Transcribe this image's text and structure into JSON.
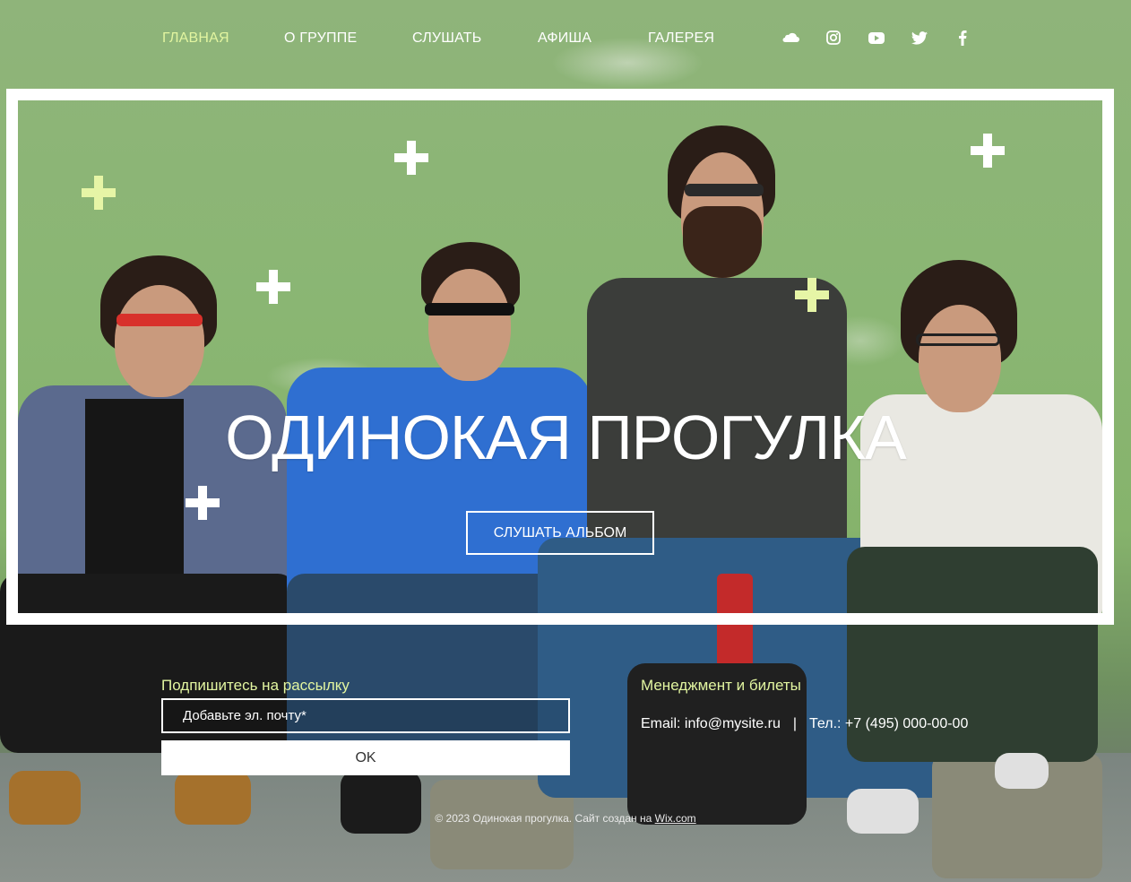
{
  "nav": {
    "items": [
      {
        "label": "ГЛАВНАЯ"
      },
      {
        "label": "О ГРУППЕ"
      },
      {
        "label": "СЛУШАТЬ"
      },
      {
        "label": "АФИША"
      },
      {
        "label": "ГАЛЕРЕЯ"
      }
    ],
    "social": [
      "soundcloud-icon",
      "instagram-icon",
      "youtube-icon",
      "twitter-icon",
      "facebook-icon"
    ]
  },
  "hero": {
    "title": "ОДИНОКАЯ ПРОГУЛКА",
    "button_label": "СЛУШАТЬ АЛЬБОМ"
  },
  "newsletter": {
    "title": "Подпишитесь на рассылку",
    "placeholder": "Добавьте эл. почту*",
    "button_label": "OK"
  },
  "management": {
    "title": "Менеджмент и билеты",
    "email": "Email: info@mysite.ru",
    "separator": "|",
    "phone": "Тел.: +7 (495) 000-00-00"
  },
  "footer": {
    "copyright": "© 2023 Одинокая прогулка. Сайт создан на ",
    "link_label": "Wix.com"
  },
  "colors": {
    "accent": "#e2f5a0",
    "sparkle_light": "#ffffff",
    "sparkle_lime": "#e6f5a6"
  }
}
